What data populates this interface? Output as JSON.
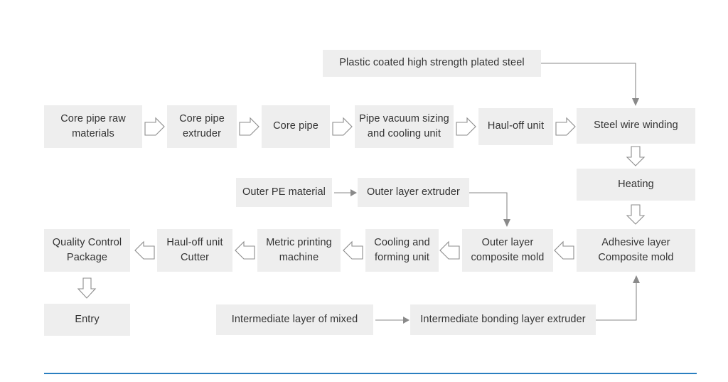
{
  "page": {
    "title": "Plastic coated steel pipe production process flowchart",
    "background_color": "#ffffff",
    "node_fill_color": "#eeeeee",
    "node_text_color": "#333333",
    "arrow_outline_color": "#8c8c8c",
    "line_color": "#8a8a8a",
    "accent_rule_color": "#2a7fc0"
  },
  "nodes": {
    "plastic_coated_steel": "Plastic coated high strength plated steel",
    "core_pipe_raw_materials": "Core pipe raw\nmaterials",
    "core_pipe_extruder": "Core pipe\nextruder",
    "core_pipe": "Core pipe",
    "pipe_vacuum_sizing": "Pipe vacuum sizing\nand cooling unit",
    "haul_off_unit": "Haul-off unit",
    "steel_wire_winding": "Steel wire winding",
    "heating": "Heating",
    "outer_pe_material": "Outer PE material",
    "outer_layer_extruder": "Outer layer extruder",
    "quality_control_package": "Quality Control\nPackage",
    "haul_off_unit_cutter": "Haul-off unit\nCutter",
    "metric_printing_machine": "Metric printing\nmachine",
    "cooling_and_forming_unit": "Cooling and\nforming unit",
    "outer_layer_composite_mold": "Outer layer\ncomposite mold",
    "adhesive_layer_composite_mold": "Adhesive layer\nComposite mold",
    "entry": "Entry",
    "intermediate_layer_of_mixed": "Intermediate layer of mixed",
    "intermediate_bonding_layer_extruder": "Intermediate bonding layer extruder"
  },
  "connectors": {
    "raw_to_extruder": "block-arrow-right-icon",
    "extruder_to_core_pipe": "block-arrow-right-icon",
    "core_pipe_to_vacuum": "block-arrow-right-icon",
    "vacuum_to_haul_off": "block-arrow-right-icon",
    "haul_off_to_steel_wire": "block-arrow-right-icon",
    "steel_wire_to_heating": "block-arrow-down-icon",
    "heating_to_adhesive": "block-arrow-down-icon",
    "adhesive_to_outer_mold": "block-arrow-left-icon",
    "outer_mold_to_cooling": "block-arrow-left-icon",
    "cooling_to_printing": "block-arrow-left-icon",
    "printing_to_cutter": "block-arrow-left-icon",
    "cutter_to_quality": "block-arrow-left-icon",
    "quality_to_entry": "block-arrow-down-icon",
    "plated_steel_to_steel_wire": "elbow-line-arrow-icon",
    "pe_material_to_extruder": "line-arrow-right-icon",
    "outer_extruder_to_mold": "elbow-line-arrow-icon",
    "mixed_to_bonding_extruder": "line-arrow-right-icon",
    "bonding_extruder_to_adhesive": "elbow-line-arrow-up-icon"
  }
}
